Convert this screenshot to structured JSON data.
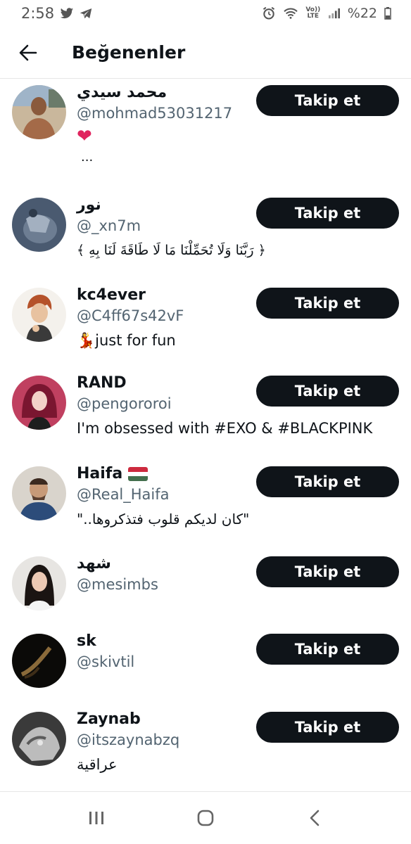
{
  "status_bar": {
    "time": "2:58",
    "volte": "Vo)) LTE",
    "battery": "%22"
  },
  "header": {
    "title": "Beğenenler"
  },
  "colors": {
    "follow_button": "#0f1419",
    "handle_text": "#536471",
    "heart": "#e0245e"
  },
  "users": [
    {
      "name": "محمد سيدي",
      "handle": "@mohmad53031217",
      "bio": "❤",
      "bio2": "...",
      "button": "Takip et"
    },
    {
      "name": "نور",
      "handle": "@_xn7m",
      "bio": "﴿ رَبَّنَا وَلَا تُحَمِّلْنَا مَا لَا طَاقَةَ لَنَا بِهِ ﴾",
      "button": "Takip et"
    },
    {
      "name": "kc4ever",
      "handle": "@C4ff67s42vF",
      "bio": "💃just for fun",
      "button": "Takip et"
    },
    {
      "name": "RAND",
      "handle": "@pengororoi",
      "bio": "I'm obsessed with #EXO & #BLACKPINK",
      "button": "Takip et"
    },
    {
      "name": "Haifa",
      "flag": "🇭🇺",
      "handle": "@Real_Haifa",
      "bio": "\"كان لديكم قلوب فتذكروها..\"",
      "button": "Takip et"
    },
    {
      "name": "شهد",
      "handle": "@mesimbs",
      "button": "Takip et"
    },
    {
      "name": "sk",
      "handle": "@skivtil",
      "button": "Takip et"
    },
    {
      "name": "Zaynab",
      "handle": "@itszaynabzq",
      "bio": "عراقية",
      "button": "Takip et"
    }
  ],
  "nav": {
    "recent": "recent-apps-icon",
    "home": "home-icon",
    "back": "back-icon"
  }
}
